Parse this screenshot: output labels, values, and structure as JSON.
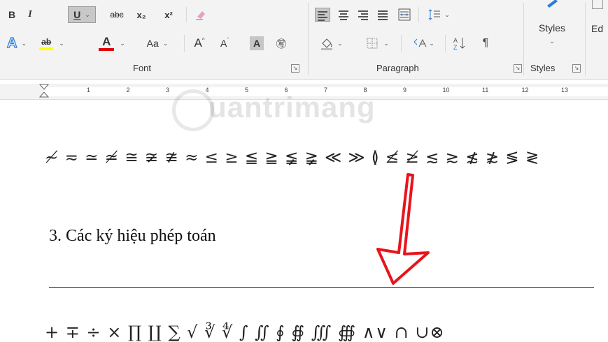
{
  "ribbon": {
    "font_group": {
      "label": "Font",
      "row1": [
        "B",
        "I",
        "U",
        "abc",
        "x₂",
        "x²"
      ],
      "row2": [
        "A",
        "ab",
        "A",
        "Aa",
        "A",
        "A",
        "A",
        "㊢"
      ]
    },
    "paragraph_group": {
      "label": "Paragraph",
      "sort": "A↓Z",
      "pilcrow": "¶"
    },
    "styles_group": {
      "label": "Styles",
      "button_label": "Styles"
    },
    "editing_button_label": "Ed",
    "colors": {
      "highlight": "#ffff00",
      "font_color": "#e00000",
      "selected_bg": "#c8c8c8"
    }
  },
  "ruler": {
    "numbers": [
      "1",
      "2",
      "3",
      "4",
      "5",
      "6",
      "7",
      "8",
      "9",
      "10",
      "11",
      "12",
      "13"
    ]
  },
  "watermark": {
    "text": "uantrimang"
  },
  "document": {
    "symbols_line": "≁ ≂ ≃ ≄ ≅ ≆ ≇ ≈ ≤ ≥ ≦ ≧ ≨ ≩ ≪ ≫ ≬ ≰ ≱ ≲ ≳ ≴ ≵ ≶ ≷",
    "heading": "3. Các ký hiệu phép toán",
    "operators_line": "+ ∓ ÷  × ∏ ∐ ∑ √ ∛ ∜ ∫ ∬ ∮ ∯ ∭ ∰ ∧∨ ∩ ∪⊗",
    "arrow_color": "#e8141c"
  }
}
